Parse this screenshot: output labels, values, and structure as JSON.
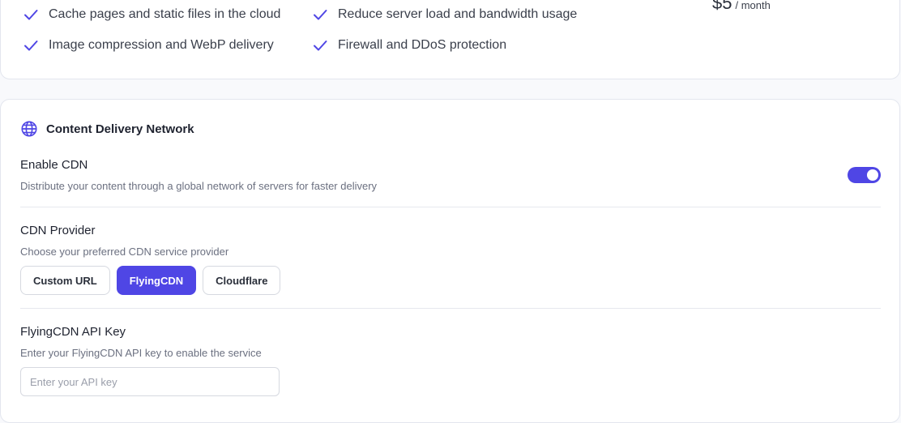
{
  "plan_card": {
    "features": [
      "Cache pages and static files in the cloud",
      "Reduce server load and bandwidth usage",
      "Image compression and WebP delivery",
      "Firewall and DDoS protection"
    ],
    "price_amount": "$5",
    "price_period": "/ month"
  },
  "cdn_card": {
    "title": "Content Delivery Network",
    "title_icon": "globe-icon",
    "enable": {
      "label": "Enable CDN",
      "description": "Distribute your content through a global network of servers for faster delivery",
      "enabled": true
    },
    "provider": {
      "label": "CDN Provider",
      "description": "Choose your preferred CDN service provider",
      "options": [
        "Custom URL",
        "FlyingCDN",
        "Cloudflare"
      ],
      "selected": "FlyingCDN"
    },
    "api_key": {
      "label": "FlyingCDN API Key",
      "description": "Enter your FlyingCDN API key to enable the service",
      "placeholder": "Enter your API key",
      "value": ""
    }
  },
  "colors": {
    "accent": "#4f46e5",
    "text": "#1f2330",
    "muted": "#6b7080",
    "border": "#e3e6ee"
  }
}
